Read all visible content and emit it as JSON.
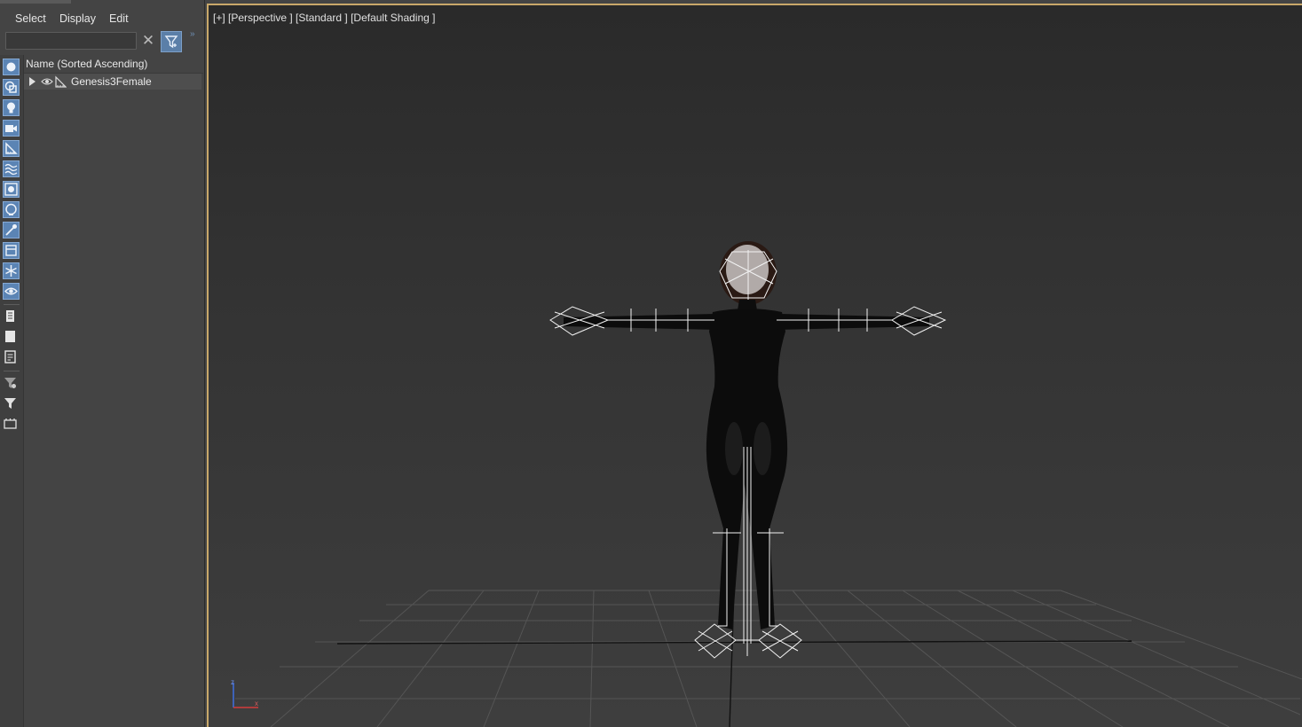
{
  "explorer": {
    "menu": [
      {
        "label": "Select"
      },
      {
        "label": "Display"
      },
      {
        "label": "Edit"
      }
    ],
    "search": {
      "value": "",
      "placeholder": ""
    },
    "column_header": "Name (Sorted Ascending)",
    "tree": [
      {
        "label": "Genesis3Female",
        "icon": "bone-icon",
        "expanded": false
      }
    ],
    "toolbar_icons": [
      "geometry-filter-icon",
      "shapes-filter-icon",
      "lights-filter-icon",
      "cameras-filter-icon",
      "bones-filter-icon",
      "spacewarps-filter-icon",
      "groups-filter-icon",
      "xrefs-filter-icon",
      "helpers-filter-icon",
      "layers-icon",
      "freeze-icon",
      "hide-icon",
      "select-all-icon",
      "select-none-icon",
      "invert-selection-icon",
      "filter-options-icon",
      "display-filter-icon",
      "container-icon"
    ]
  },
  "viewport": {
    "label": "[+] [Perspective ] [Standard ] [Default Shading ]",
    "accent_color": "#c9a86a"
  }
}
